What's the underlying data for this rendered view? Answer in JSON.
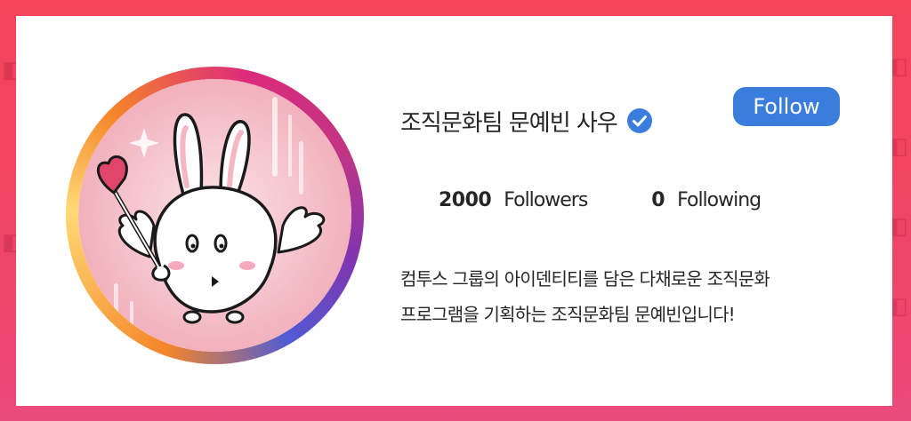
{
  "profile": {
    "name": "조직문화팀 문예빈 사우",
    "follow_label": "Follow",
    "followers_count": "2000",
    "followers_label": "Followers",
    "following_count": "0",
    "following_label": "Following",
    "bio_line1": "컴투스 그룹의 아이덴티티를 담은 다채로운 조직문화",
    "bio_line2": "프로그램을 기획하는 조직문화팀 문예빈입니다!"
  },
  "icons": {
    "verified": "verified-check-icon",
    "avatar": "bunny-angel-illustration",
    "background_pattern": "instagram-logo-icon"
  },
  "colors": {
    "background": "#f5445a",
    "card": "#ffffff",
    "follow_button": "#3b7ddd",
    "verified_badge": "#3b7ddd",
    "text": "#262626",
    "ring_orange": "#f58529",
    "ring_pink": "#dd2a7b",
    "ring_purple": "#8134af",
    "ring_blue": "#515bd4"
  }
}
